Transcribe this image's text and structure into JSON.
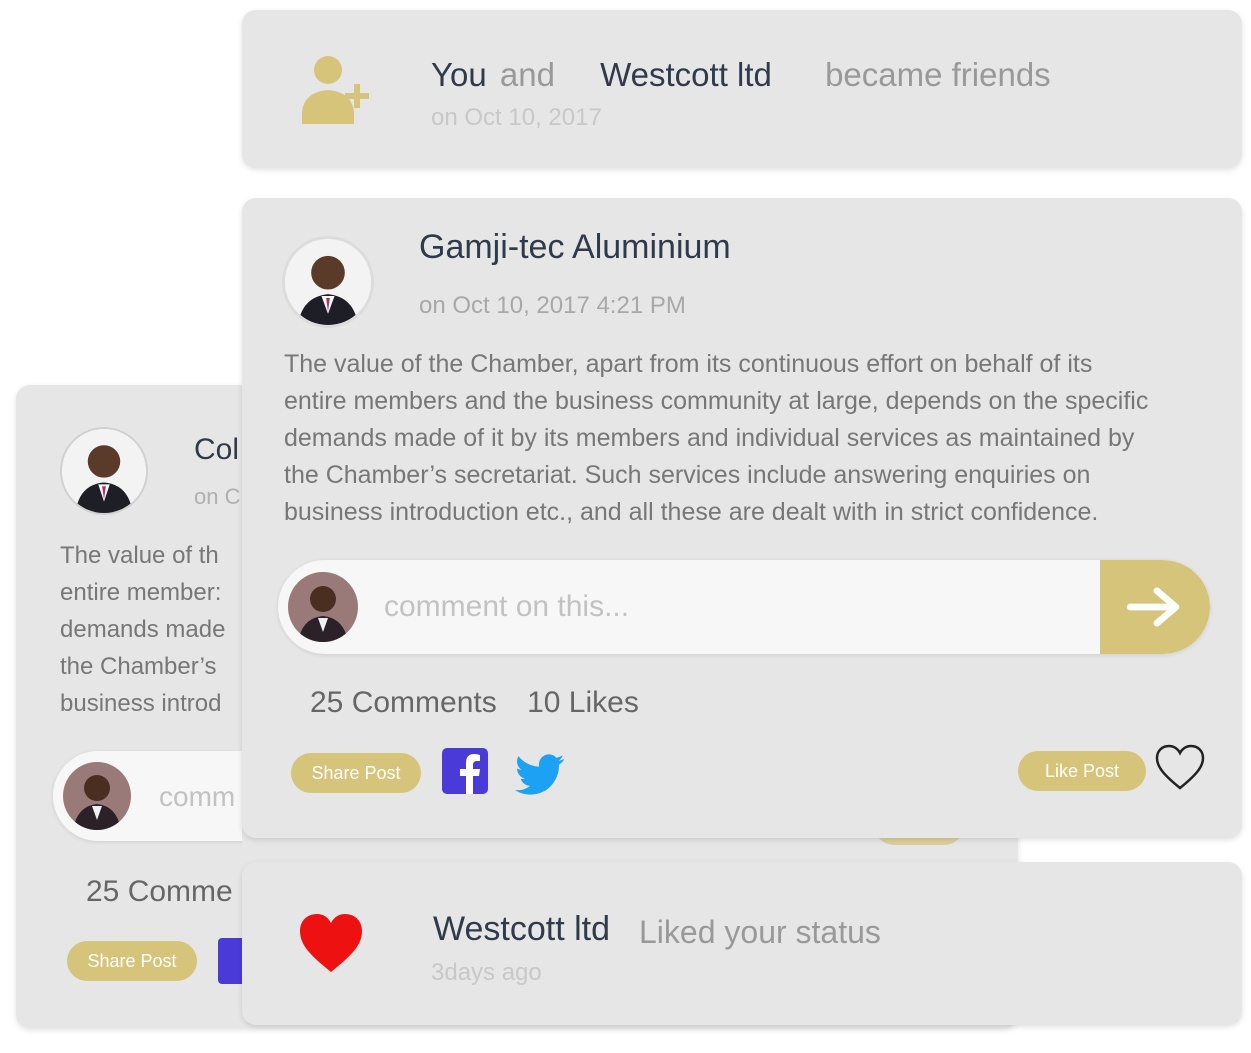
{
  "friend_card": {
    "you": "You",
    "and": "and",
    "name": "Westcott ltd",
    "action": "became friends",
    "date": "on Oct 10, 2017",
    "icon": "add-friend-icon"
  },
  "post": {
    "author": "Gamji-tec Aluminium",
    "date": "on Oct 10, 2017 4:21 PM",
    "body_lines": [
      "The value of the Chamber, apart from its continuous effort on behalf of its",
      "entire members and the business community at large, depends on the specific",
      "demands made of it by its members and individual services as maintained by",
      "the Chamber’s secretariat. Such services include answering enquiries on",
      "business introduction etc., and all these are dealt with in strict confidence."
    ],
    "comment_placeholder": "comment on this...",
    "comments": "25 Comments",
    "likes": "10 Likes",
    "share_label": "Share Post",
    "like_label": "Like Post"
  },
  "back_post": {
    "author": "Col",
    "date": "on C",
    "body_lines": [
      "The value of th",
      "entire member:",
      "demands made",
      "the Chamber’s",
      "business introd"
    ],
    "comment_placeholder": "comm",
    "comments": "25 Comme",
    "share_label": "Share Post"
  },
  "liked_card": {
    "name": "Westcott ltd",
    "action": "Liked your status",
    "time": "3days ago"
  },
  "colors": {
    "card": "#e6e6e6",
    "gold": "#d6c47a",
    "facebook": "#4a3bd8",
    "twitter": "#1da1f2",
    "heart": "#ee1111"
  }
}
